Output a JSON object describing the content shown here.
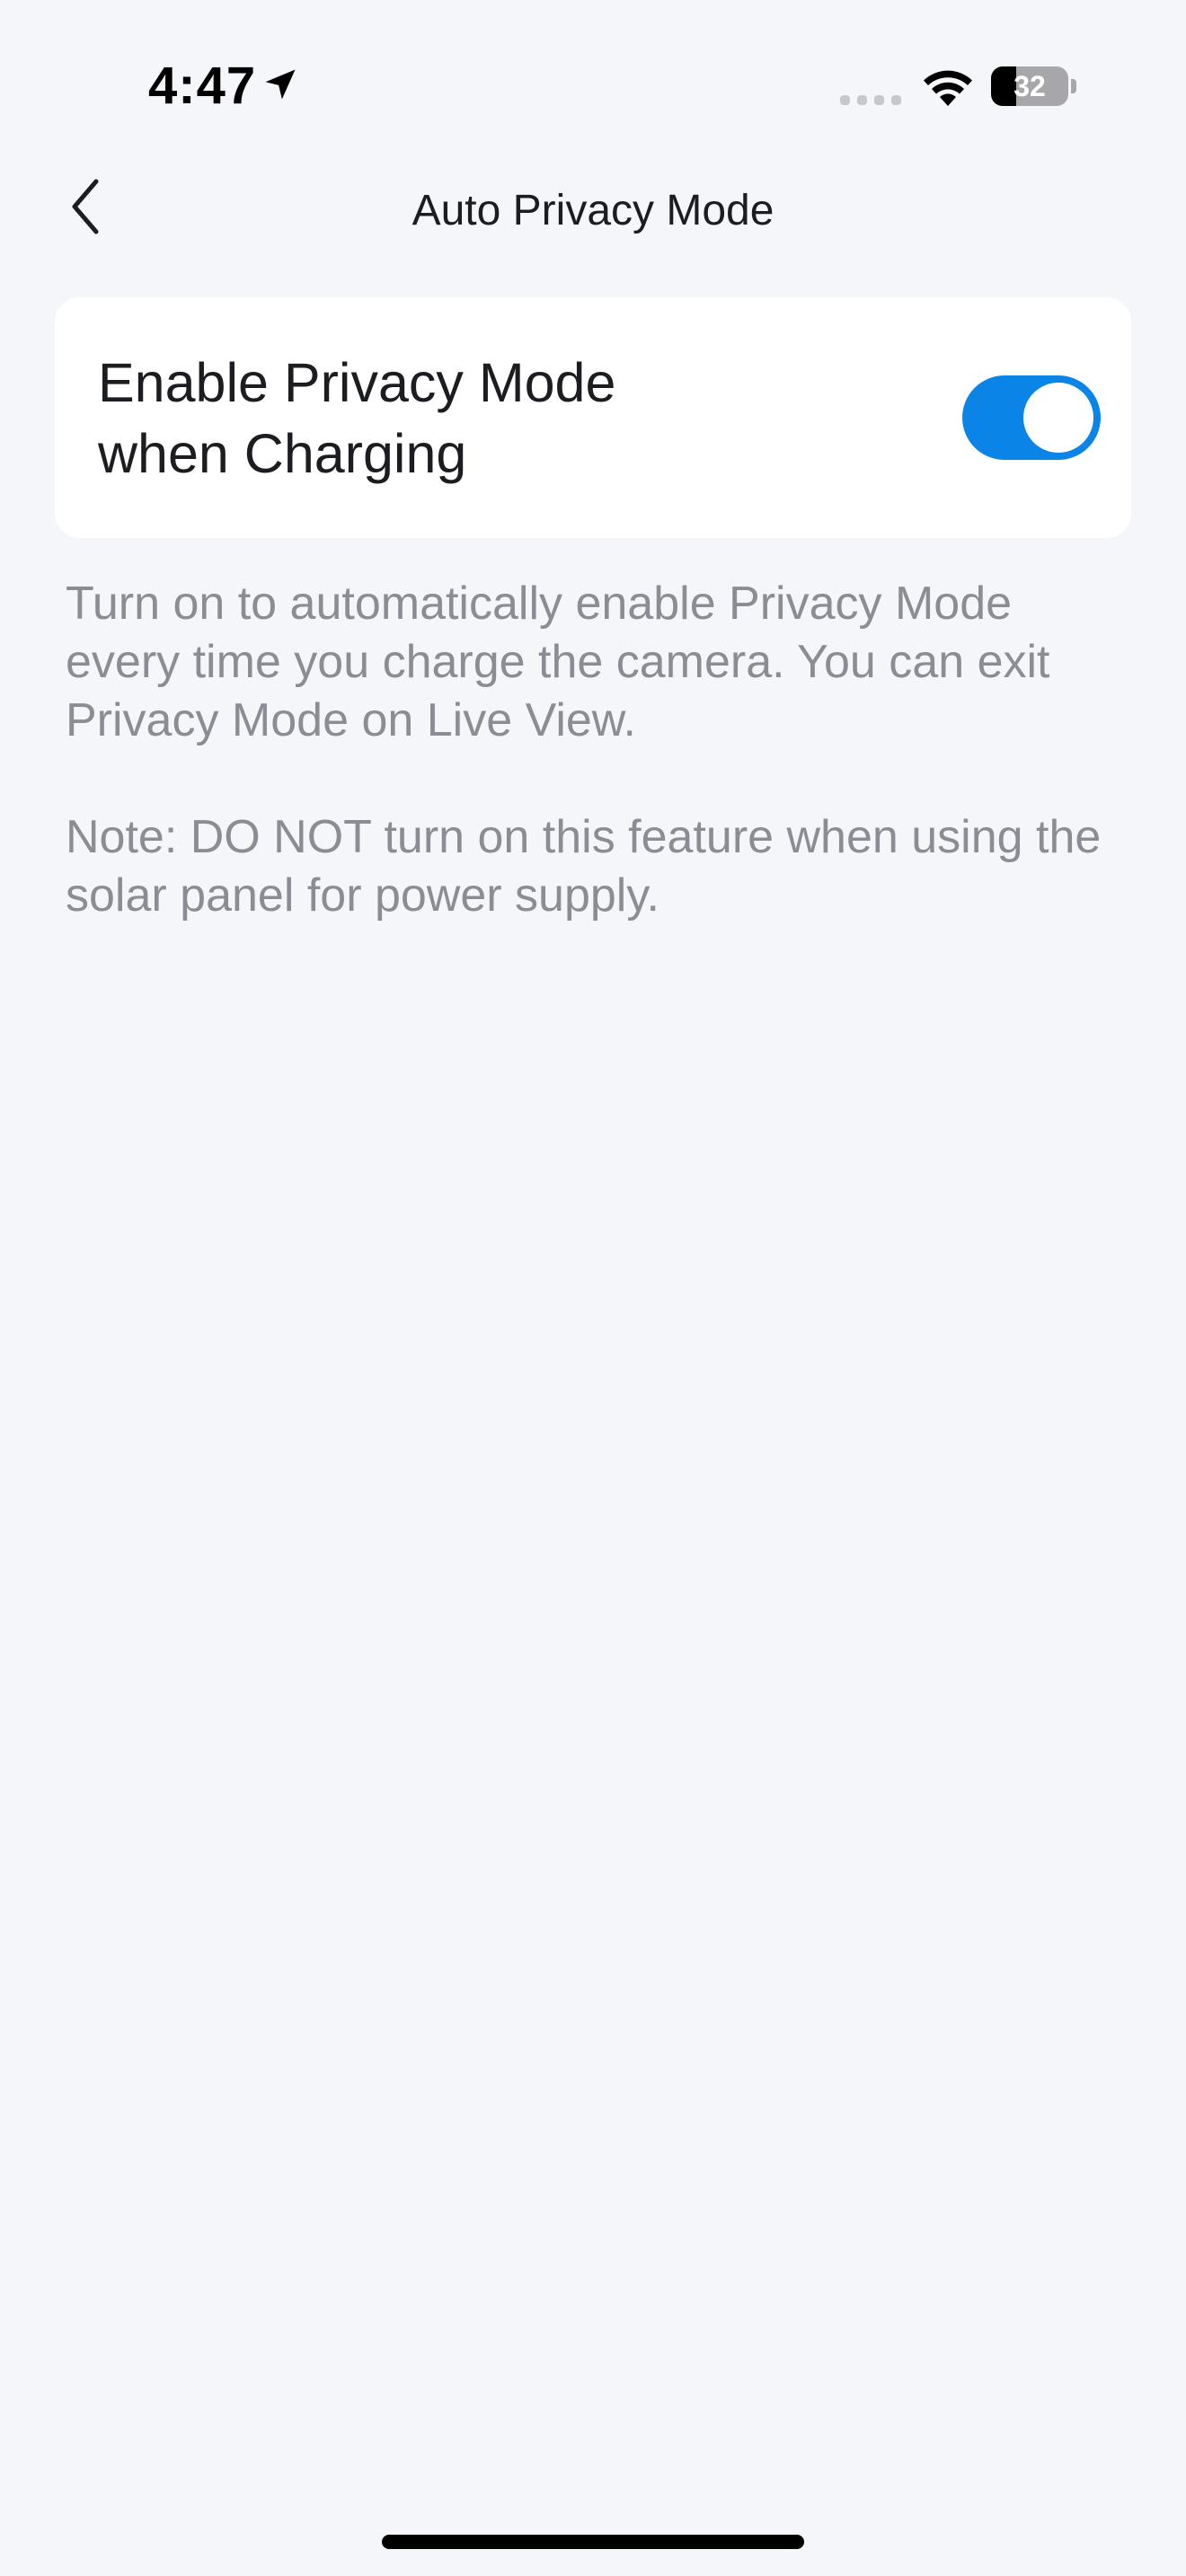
{
  "status_bar": {
    "time": "4:47",
    "battery_level": "32",
    "battery_percent": 32,
    "icons": [
      "location-arrow-icon",
      "signal-icon",
      "wifi-icon",
      "battery-icon"
    ]
  },
  "nav": {
    "title": "Auto Privacy Mode",
    "back_icon": "chevron-left-icon"
  },
  "setting": {
    "label": "Enable Privacy Mode\nwhen Charging",
    "enabled": true,
    "toggle_color": "#0a84e6"
  },
  "description": "Turn on to automatically enable Privacy Mode every time you charge the camera. You can exit Privacy Mode on Live View.",
  "note": "Note: DO NOT turn on this feature when using the solar panel for power supply."
}
